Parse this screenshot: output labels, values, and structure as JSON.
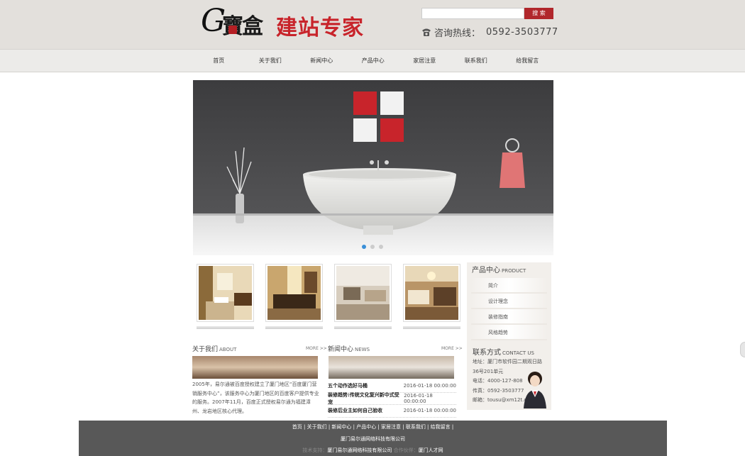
{
  "header": {
    "logo_letter": "G",
    "logo_chars": "寶盒",
    "logo_slogan": "建站专家",
    "search_placeholder": "",
    "search_button": "搜 索",
    "hotline_label": "咨询热线：",
    "hotline_number": "0592-3503777"
  },
  "nav": {
    "items": [
      "首页",
      "关于我们",
      "新闻中心",
      "产品中心",
      "家居注意",
      "联系我们",
      "给我留言"
    ]
  },
  "banner": {
    "slides": 3,
    "active_slide": 1
  },
  "about": {
    "title": "关于我们",
    "title_en": "ABOUT",
    "more": "MORE >>",
    "text": "2005年，易尔通被百度授权建立了厦门地区“百度厦门营销服务中心”，该服务中心为厦门地区的百度客户提供专业的服务。2007年11月，百度正式授权易尔通为福建漳州、龙岩地区核心代理。"
  },
  "news": {
    "title": "新闻中心",
    "title_en": "NEWS",
    "more": "MORE >>",
    "items": [
      {
        "title": "五个动作选好马桶",
        "date": "2016-01-18 00:00:00"
      },
      {
        "title": "装修趋势:传统文化复兴新中式受宠",
        "date": "2016-01-18 00:00:00"
      },
      {
        "title": "装修后业主如何自己验收",
        "date": "2016-01-18 00:00:00"
      }
    ]
  },
  "sidebar": {
    "title": "产品中心",
    "title_en": "PRODUCT",
    "items": [
      "简介",
      "设计理念",
      "装修指南",
      "风格趋势"
    ]
  },
  "contact": {
    "title": "联系方式",
    "title_en": "CONTACT US",
    "address": "地址：厦门市软件园二期观日路36号201单元",
    "phone": "电话：4000-127-808",
    "fax": "传真：0592-3503777",
    "email": "邮箱：tousu@xm12t.com"
  },
  "footer": {
    "links": "首页 | 关于我们 | 新闻中心 | 产品中心 | 家居注意 | 联系我们 | 给我留言 |",
    "company": "厦门易尔通网络科技有限公司",
    "tech_label": "技术支持：",
    "tech_company": "厦门易尔通网络科技有限公司",
    "partner_label": "合作伙伴：",
    "partner": "厦门人才网"
  },
  "colors": {
    "accent_red": "#b1272c",
    "header_bg": "#e3e0dc",
    "footer_bg": "#585858",
    "dot_active": "#3a8fd8"
  }
}
